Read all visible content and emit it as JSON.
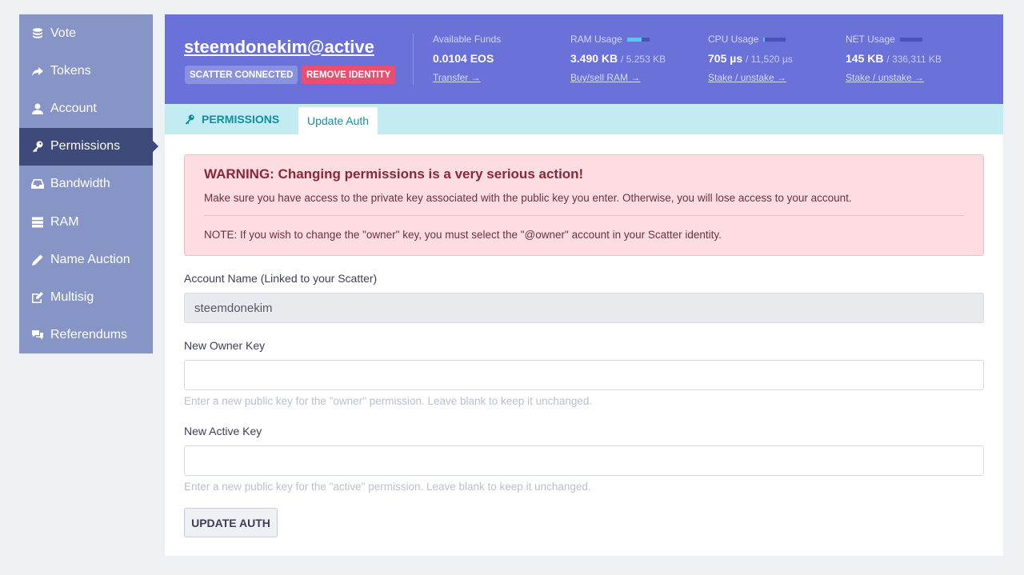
{
  "sidebar": {
    "items": [
      {
        "label": "Vote",
        "icon": "coins-icon"
      },
      {
        "label": "Tokens",
        "icon": "share-arrow-icon"
      },
      {
        "label": "Account",
        "icon": "user-icon"
      },
      {
        "label": "Permissions",
        "icon": "key-icon",
        "active": true
      },
      {
        "label": "Bandwidth",
        "icon": "inbox-icon"
      },
      {
        "label": "RAM",
        "icon": "server-icon"
      },
      {
        "label": "Name Auction",
        "icon": "pencil-icon"
      },
      {
        "label": "Multisig",
        "icon": "edit-icon"
      },
      {
        "label": "Referendums",
        "icon": "comments-icon"
      }
    ]
  },
  "header": {
    "account": "steemdonekim@active",
    "badge_scatter": "SCATTER CONNECTED",
    "badge_remove": "REMOVE IDENTITY",
    "funds": {
      "label": "Available Funds",
      "value": "0.0104 EOS",
      "link": "Transfer →"
    },
    "ram": {
      "label": "RAM Usage",
      "value": "3.490 KB",
      "total": "/ 5.253 KB",
      "link": "Buy/sell RAM →",
      "fill": 0.66
    },
    "cpu": {
      "label": "CPU Usage",
      "value": "705 µs",
      "total": "/ 11,520 µs",
      "link": "Stake / unstake →",
      "fill": 0.06
    },
    "net": {
      "label": "NET Usage",
      "value": "145 KB",
      "total": "/ 336,311 KB",
      "link": "Stake / unstake →",
      "fill": 0.0
    }
  },
  "tabs": {
    "section": "PERMISSIONS",
    "active_tab": "Update Auth"
  },
  "warning": {
    "title": "WARNING: Changing permissions is a very serious action!",
    "text": "Make sure you have access to the private key associated with the public key you enter. Otherwise, you will lose access to your account.",
    "note": "NOTE: If you wish to change the \"owner\" key, you must select the \"@owner\" account in your Scatter identity."
  },
  "form": {
    "account_label": "Account Name (Linked to your Scatter)",
    "account_value": "steemdonekim",
    "owner_label": "New Owner Key",
    "owner_value": "",
    "owner_help": "Enter a new public key for the \"owner\" permission. Leave blank to keep it unchanged.",
    "active_label": "New Active Key",
    "active_value": "",
    "active_help": "Enter a new public key for the \"active\" permission. Leave blank to keep it unchanged.",
    "submit": "UPDATE AUTH"
  },
  "colors": {
    "header_bg": "#6a71d8",
    "sidebar_bg": "#8795c6",
    "sidebar_active": "#3e4a7a",
    "tabbar_bg": "#c2ecf2",
    "warning_bg": "#fddde2",
    "remove_badge": "#ec4e72"
  }
}
